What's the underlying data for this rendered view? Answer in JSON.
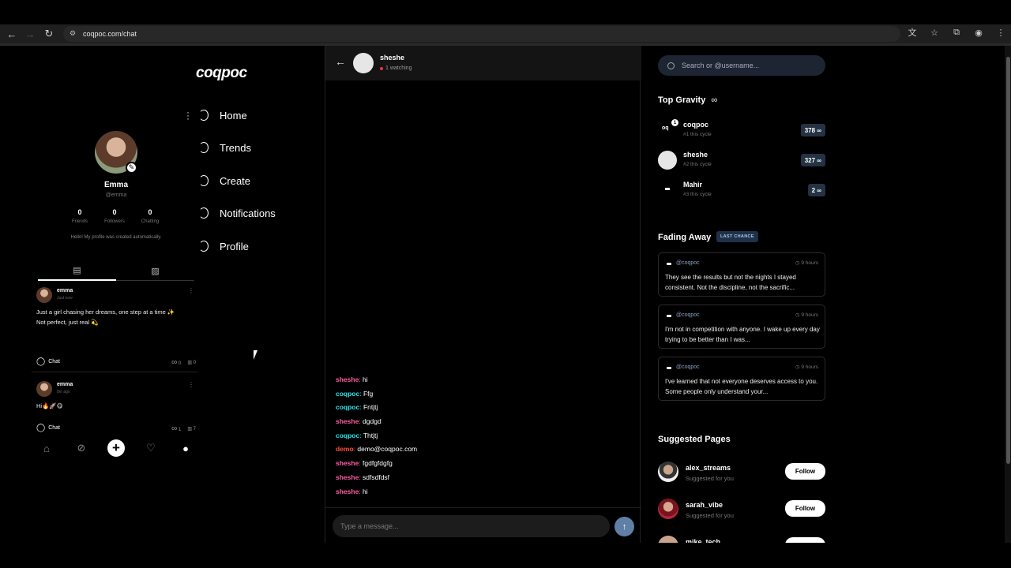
{
  "browser": {
    "url": "coqpoc.com/chat",
    "nav_icons": [
      "back-icon",
      "forward-icon",
      "reload-icon",
      "site-settings-icon"
    ],
    "right_icons": [
      "translate-icon",
      "star-icon",
      "extensions-icon",
      "account-icon",
      "more-icon"
    ]
  },
  "app": {
    "logo": "coqpoc"
  },
  "profile": {
    "name": "Emma",
    "username": "@emma",
    "stats": [
      {
        "value": "0",
        "label": "Friends"
      },
      {
        "value": "0",
        "label": "Followers"
      },
      {
        "value": "0",
        "label": "Chatting"
      }
    ],
    "bio": "Hello! My profile was created automatically."
  },
  "posts": [
    {
      "author": "emma",
      "time": "Just now",
      "text": "Just a girl chasing her dreams, one step at a time ✨\nNot perfect, just real 💫",
      "chat_label": "Chat",
      "gravity": "0",
      "views": "0"
    },
    {
      "author": "emma",
      "time": "8m ago",
      "text": "Hi🔥🚀😋",
      "chat_label": "Chat",
      "gravity": "1",
      "views": "7"
    }
  ],
  "nav": [
    {
      "label": "Home"
    },
    {
      "label": "Trends"
    },
    {
      "label": "Create"
    },
    {
      "label": "Notifications"
    },
    {
      "label": "Profile"
    }
  ],
  "chat": {
    "name": "sheshe",
    "watching": "1 watching",
    "messages": [
      {
        "user": "sheshe",
        "text": "hi",
        "color": "#ff5fa2"
      },
      {
        "user": "coqpoc",
        "text": "Ffg",
        "color": "#33e0e6"
      },
      {
        "user": "coqpoc",
        "text": "Fntjtj",
        "color": "#33e0e6"
      },
      {
        "user": "sheshe",
        "text": "dgdgd",
        "color": "#ff5fa2"
      },
      {
        "user": "coqpoc",
        "text": "Thtjtj",
        "color": "#33e0e6"
      },
      {
        "user": "demo",
        "text": "demo@coqpoc.com",
        "color": "#ff4a3d"
      },
      {
        "user": "sheshe",
        "text": "fgdfgfdgfg",
        "color": "#ff5fa2"
      },
      {
        "user": "sheshe",
        "text": "sdfsdfdsf",
        "color": "#ff5fa2"
      },
      {
        "user": "sheshe",
        "text": "hi",
        "color": "#ff5fa2"
      }
    ],
    "input_placeholder": "Type a message..."
  },
  "search": {
    "placeholder": "Search or @username..."
  },
  "top_gravity": {
    "title": "Top Gravity",
    "symbol": "∞",
    "items": [
      {
        "name": "coqpoc",
        "rank": "#1 this cycle",
        "score": "378 ∞",
        "notif": "1"
      },
      {
        "name": "sheshe",
        "rank": "#2 this cycle",
        "score": "327 ∞"
      },
      {
        "name": "Mahir",
        "rank": "#3 this cycle",
        "score": "2 ∞"
      }
    ]
  },
  "fading_away": {
    "title": "Fading Away",
    "badge": "LAST CHANCE",
    "items": [
      {
        "user": "@coqpoc",
        "time": "9 hours",
        "text": "They see the results but not the nights I stayed consistent. Not the discipline, not the sacrific..."
      },
      {
        "user": "@coqpoc",
        "time": "9 hours",
        "text": "I'm not in competition with anyone. I wake up every day trying to be better than I was..."
      },
      {
        "user": "@coqpoc",
        "time": "9 hours",
        "text": "I've learned that not everyone deserves access to you. Some people only understand your..."
      }
    ]
  },
  "suggested": {
    "title": "Suggested Pages",
    "items": [
      {
        "name": "alex_streams",
        "sub": "Suggested for you",
        "button": "Follow"
      },
      {
        "name": "sarah_vibe",
        "sub": "Suggested for you",
        "button": "Follow"
      },
      {
        "name": "mike_tech"
      }
    ]
  }
}
